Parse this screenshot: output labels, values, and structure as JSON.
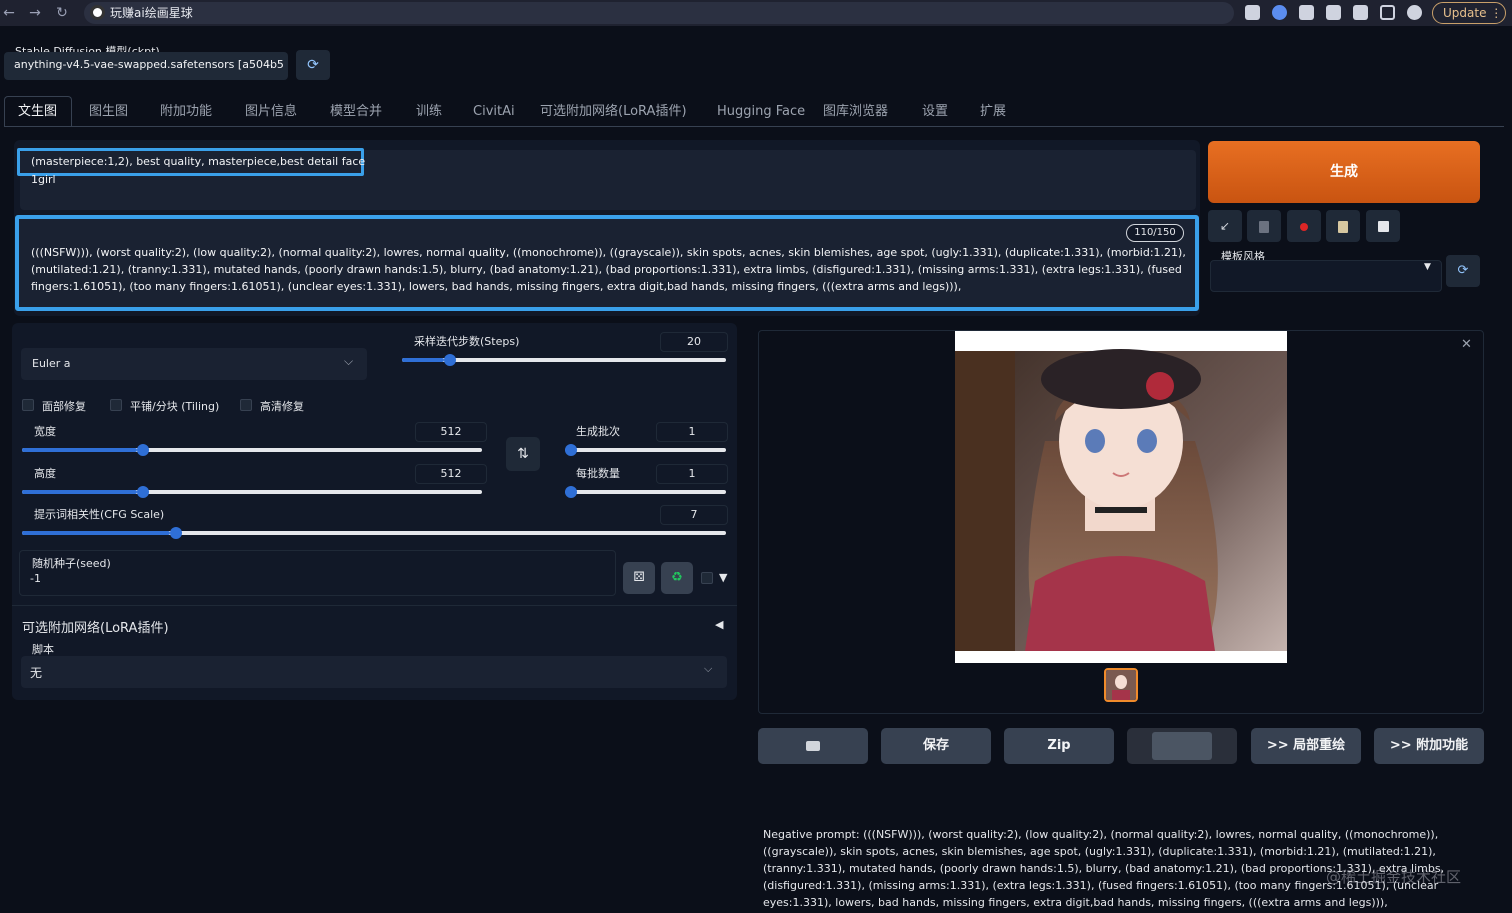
{
  "browser": {
    "tab_title": "玩赚ai绘画星球",
    "update_label": "Update"
  },
  "model": {
    "label": "Stable Diffusion 模型(ckpt)",
    "value": "anything-v4.5-vae-swapped.safetensors [a504b5"
  },
  "tabs": [
    {
      "label": "文生图"
    },
    {
      "label": "图生图"
    },
    {
      "label": "附加功能"
    },
    {
      "label": "图片信息"
    },
    {
      "label": "模型合并"
    },
    {
      "label": "训练"
    },
    {
      "label": "CivitAi"
    },
    {
      "label": "可选附加网络(LoRA插件)"
    },
    {
      "label": "Hugging Face"
    },
    {
      "label": "图库浏览器"
    },
    {
      "label": "设置"
    },
    {
      "label": "扩展"
    }
  ],
  "prompt": {
    "positive_line1": "(masterpiece:1,2), best quality, masterpiece,best detail face",
    "positive_line2": "1girl",
    "negative": "(((NSFW))), (worst quality:2), (low quality:2), (normal quality:2), lowres, normal quality, ((monochrome)), ((grayscale)), skin spots, acnes, skin blemishes, age spot, (ugly:1.331), (duplicate:1.331), (morbid:1.21), (mutilated:1.21), (tranny:1.331), mutated hands, (poorly drawn hands:1.5), blurry, (bad anatomy:1.21), (bad proportions:1.331), extra limbs, (disfigured:1.331), (missing arms:1.331), (extra legs:1.331), (fused fingers:1.61051), (too many fingers:1.61051), (unclear eyes:1.331), lowers, bad hands, missing fingers, extra digit,bad hands, missing fingers, (((extra arms and legs))),",
    "token_counter": "110/150"
  },
  "generate": {
    "label": "生成",
    "style_label": "模板风格"
  },
  "settings": {
    "sampler_value": "Euler a",
    "steps_label": "采样迭代步数(Steps)",
    "steps_value": "20",
    "steps_fraction": 0.13,
    "face_restore": "面部修复",
    "tiling": "平铺/分块 (Tiling)",
    "hires": "高清修复",
    "width_label": "宽度",
    "width_value": "512",
    "width_fraction": 0.25,
    "height_label": "高度",
    "height_value": "512",
    "height_fraction": 0.25,
    "batch_count_label": "生成批次",
    "batch_count_value": "1",
    "batch_count_fraction": 0.0,
    "batch_size_label": "每批数量",
    "batch_size_value": "1",
    "batch_size_fraction": 0.0,
    "cfg_label": "提示词相关性(CFG Scale)",
    "cfg_value": "7",
    "cfg_fraction": 0.21,
    "seed_label": "随机种子(seed)",
    "seed_value": "-1",
    "lora_label": "可选附加网络(LoRA插件)",
    "script_label": "脚本",
    "script_value": "无"
  },
  "output": {
    "buttons": [
      "保存",
      "Zip",
      ">> 局部重绘",
      ">> 附加功能"
    ],
    "info": "Negative prompt: (((NSFW))), (worst quality:2), (low quality:2), (normal quality:2), lowres, normal quality, ((monochrome)), ((grayscale)), skin spots, acnes, skin blemishes, age spot, (ugly:1.331), (duplicate:1.331), (morbid:1.21), (mutilated:1.21), (tranny:1.331), mutated hands, (poorly drawn hands:1.5), blurry, (bad anatomy:1.21), (bad proportions:1.331), extra limbs, (disfigured:1.331), (missing arms:1.331), (extra legs:1.331), (fused fingers:1.61051), (too many fingers:1.61051), (unclear eyes:1.331), lowers, bad hands, missing fingers, extra digit,bad hands, missing fingers, (((extra arms and legs))),",
    "watermark": "@稀土掘金技术社区"
  },
  "colors": {
    "accent": "#3aa0ea",
    "generate": "#e86f22",
    "slider": "#2f6fd6"
  }
}
